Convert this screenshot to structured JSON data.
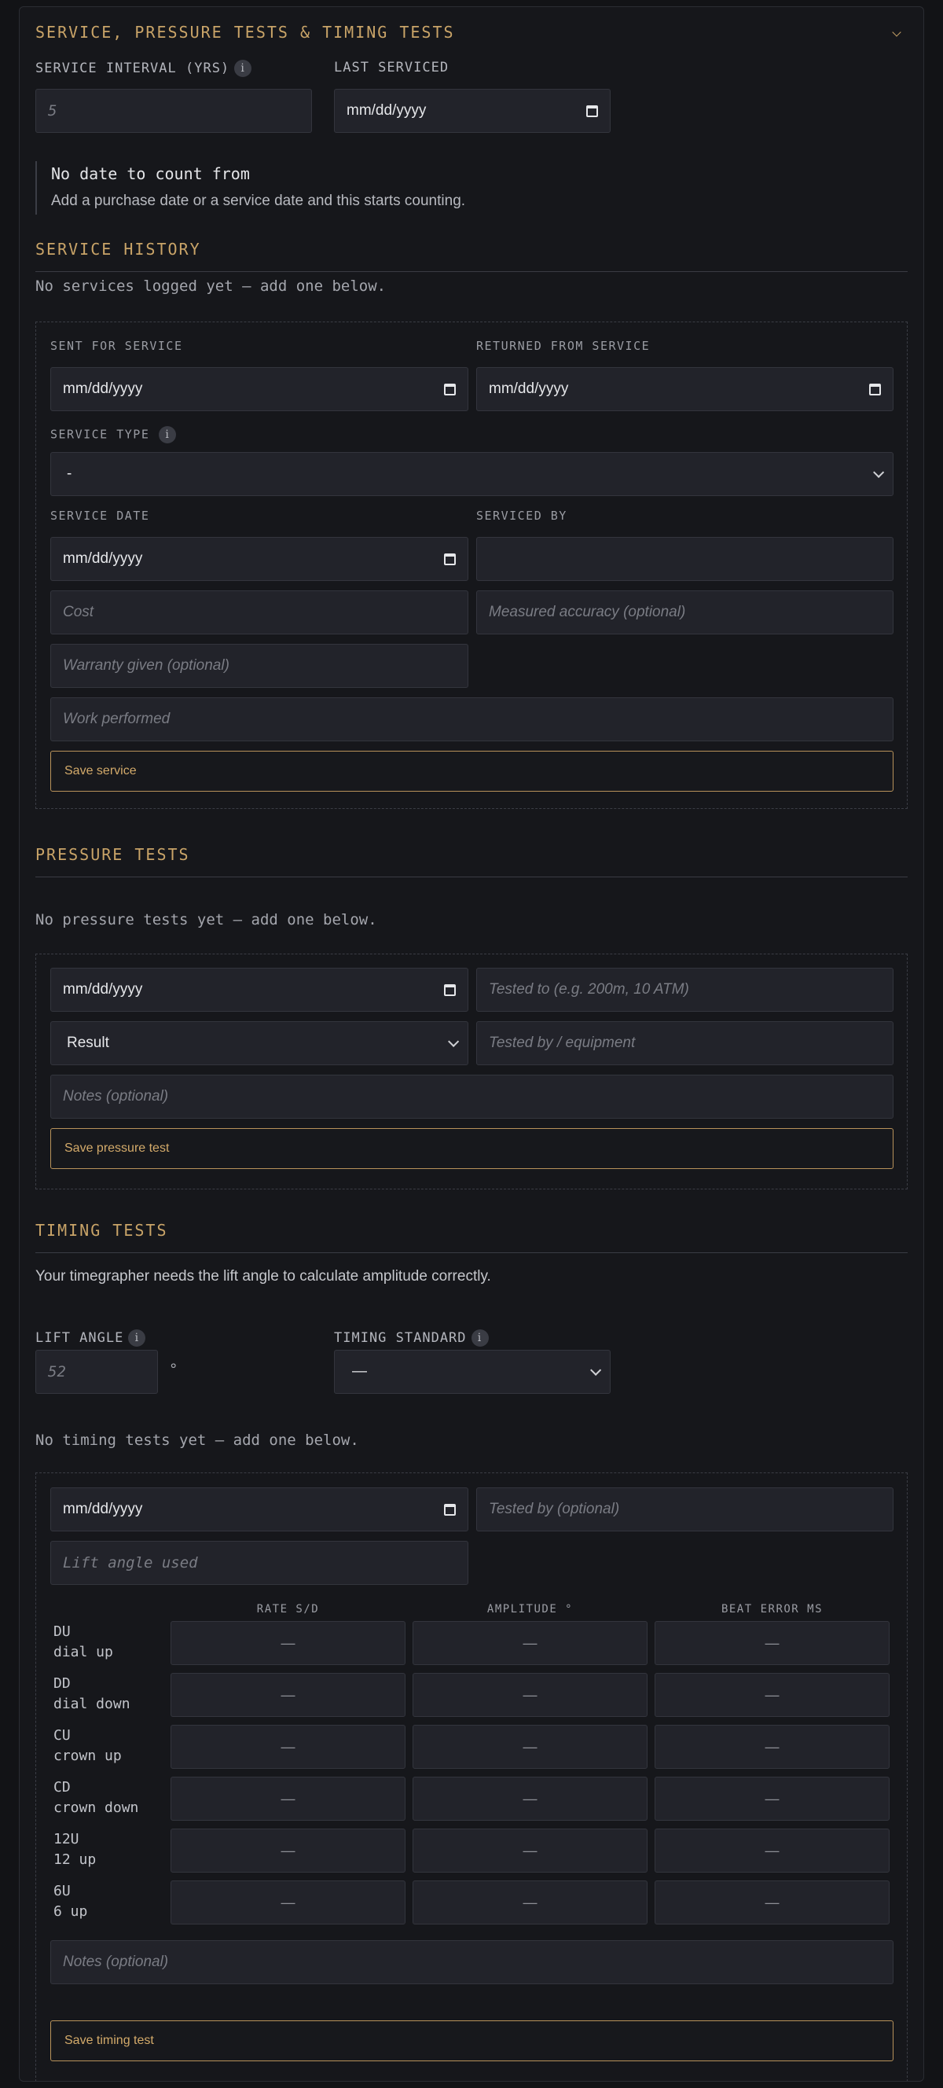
{
  "section": {
    "title": "SERVICE, PRESSURE TESTS & TIMING TESTS",
    "collapse_icon": "chevron-down-icon"
  },
  "service_settings": {
    "interval_label": "SERVICE INTERVAL (YRS)",
    "interval_placeholder": "5",
    "last_serviced_label": "LAST SERVICED",
    "last_serviced_value": "mm/dd/yyyy"
  },
  "notice": {
    "title": "No date to count from",
    "body": "Add a purchase date or a service date and this starts counting."
  },
  "service_history": {
    "title": "SERVICE HISTORY",
    "empty": "No services logged yet — add one below.",
    "form": {
      "sent_label": "SENT FOR SERVICE",
      "sent_value": "mm/dd/yyyy",
      "returned_label": "RETURNED FROM SERVICE",
      "returned_value": "mm/dd/yyyy",
      "type_label": "SERVICE TYPE",
      "type_value": "-",
      "date_label": "SERVICE DATE",
      "date_value": "mm/dd/yyyy",
      "by_label": "SERVICED BY",
      "cost_placeholder": "Cost",
      "accuracy_placeholder": "Measured accuracy (optional)",
      "warranty_placeholder": "Warranty given (optional)",
      "work_placeholder": "Work performed",
      "save_label": "Save service"
    }
  },
  "pressure_tests": {
    "title": "PRESSURE TESTS",
    "empty": "No pressure tests yet — add one below.",
    "form": {
      "date_value": "mm/dd/yyyy",
      "tested_to_placeholder": "Tested to (e.g. 200m, 10 ATM)",
      "result_value": "Result",
      "tested_by_placeholder": "Tested by / equipment",
      "notes_placeholder": "Notes (optional)",
      "save_label": "Save pressure test"
    }
  },
  "timing_tests": {
    "title": "TIMING TESTS",
    "hint": "Your timegrapher needs the lift angle to calculate amplitude correctly.",
    "lift_label": "LIFT ANGLE",
    "lift_placeholder": "52",
    "lift_unit": "°",
    "standard_label": "TIMING STANDARD",
    "standard_value": "—",
    "empty": "No timing tests yet — add one below.",
    "form": {
      "date_value": "mm/dd/yyyy",
      "tested_by_placeholder": "Tested by (optional)",
      "lift_used_placeholder": "Lift angle used",
      "columns": [
        "RATE S/D",
        "AMPLITUDE °",
        "BEAT ERROR MS"
      ],
      "cell_placeholder": "—",
      "positions": [
        {
          "code": "DU",
          "name": "dial up"
        },
        {
          "code": "DD",
          "name": "dial down"
        },
        {
          "code": "CU",
          "name": "crown up"
        },
        {
          "code": "CD",
          "name": "crown down"
        },
        {
          "code": "12U",
          "name": "12 up"
        },
        {
          "code": "6U",
          "name": "6 up"
        }
      ],
      "notes_placeholder": "Notes (optional)",
      "save_label": "Save timing test"
    }
  }
}
